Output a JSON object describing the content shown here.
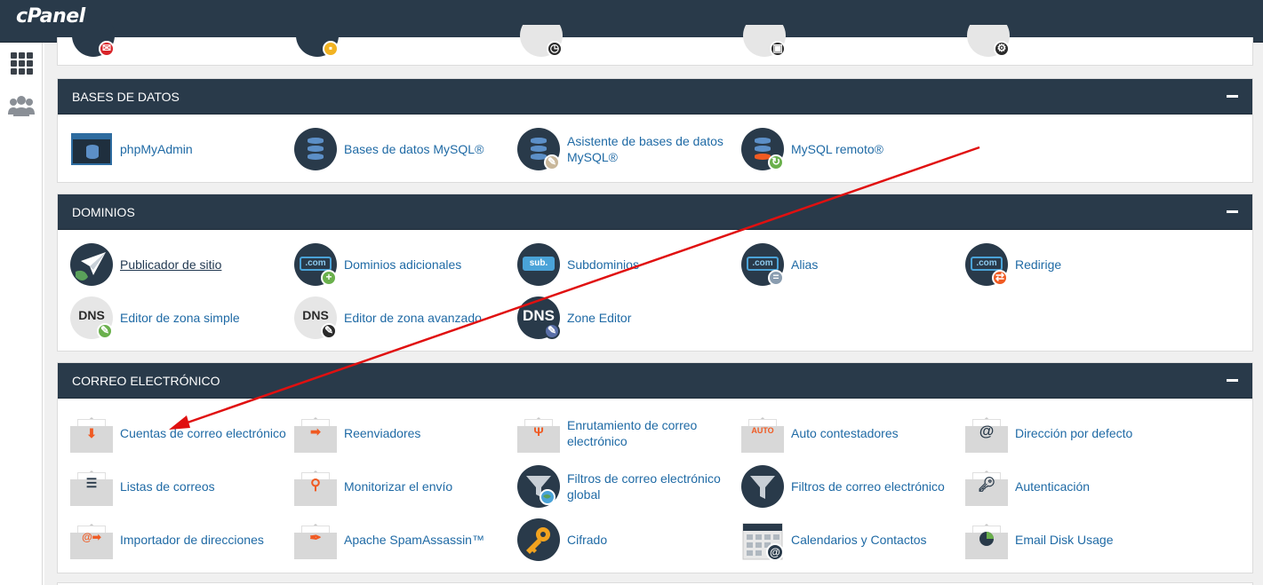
{
  "app": {
    "logo": "cPanel"
  },
  "sidebar": {
    "items": [
      {
        "icon": "apps-grid-icon"
      },
      {
        "icon": "users-icon"
      }
    ]
  },
  "sections": {
    "databases": {
      "title": "BASES DE DATOS",
      "items": [
        {
          "label": "phpMyAdmin",
          "icon": "phpmyadmin-icon"
        },
        {
          "label": "Bases de datos MySQL®",
          "icon": "mysql-database-icon"
        },
        {
          "label": "Asistente de bases de datos MySQL®",
          "icon": "mysql-wizard-icon"
        },
        {
          "label": "MySQL remoto®",
          "icon": "remote-mysql-icon"
        }
      ]
    },
    "domains": {
      "title": "DOMINIOS",
      "items": [
        {
          "label": "Publicador de sitio",
          "icon": "site-publisher-icon"
        },
        {
          "label": "Dominios adicionales",
          "icon": "addon-domains-icon"
        },
        {
          "label": "Subdominios",
          "icon": "subdomains-icon"
        },
        {
          "label": "Alias",
          "icon": "alias-icon"
        },
        {
          "label": "Redirige",
          "icon": "redirects-icon"
        },
        {
          "label": "Editor de zona simple",
          "icon": "simple-zone-editor-icon"
        },
        {
          "label": "Editor de zona avanzado",
          "icon": "advanced-zone-editor-icon"
        },
        {
          "label": "Zone Editor",
          "icon": "zone-editor-icon"
        }
      ],
      "icon_text": {
        "com": ".com",
        "sub": "sub.",
        "dns": "DNS"
      }
    },
    "email": {
      "title": "CORREO ELECTRÓNICO",
      "items": [
        {
          "label": "Cuentas de correo electrónico",
          "icon": "email-accounts-icon"
        },
        {
          "label": "Reenviadores",
          "icon": "forwarders-icon"
        },
        {
          "label": "Enrutamiento de correo electrónico",
          "icon": "email-routing-icon"
        },
        {
          "label": "Auto contestadores",
          "icon": "autoresponders-icon"
        },
        {
          "label": "Dirección por defecto",
          "icon": "default-address-icon"
        },
        {
          "label": "Listas de correos",
          "icon": "mailing-lists-icon"
        },
        {
          "label": "Monitorizar el envío",
          "icon": "track-delivery-icon"
        },
        {
          "label": "Filtros de correo electrónico global",
          "icon": "global-email-filters-icon"
        },
        {
          "label": "Filtros de correo electrónico",
          "icon": "email-filters-icon"
        },
        {
          "label": "Autenticación",
          "icon": "authentication-icon"
        },
        {
          "label": "Importador de direcciones",
          "icon": "address-importer-icon"
        },
        {
          "label": "Apache SpamAssassin™",
          "icon": "spamassassin-icon"
        },
        {
          "label": "Cifrado",
          "icon": "encryption-icon"
        },
        {
          "label": "Calendarios y Contactos",
          "icon": "calendars-contacts-icon"
        },
        {
          "label": "Email Disk Usage",
          "icon": "email-disk-usage-icon"
        }
      ],
      "icon_text": {
        "auto": "AUTO",
        "at": "@"
      }
    }
  },
  "colors": {
    "header_bg": "#293a4a",
    "link": "#1f6aa5",
    "annotation_arrow": "#e01010"
  }
}
